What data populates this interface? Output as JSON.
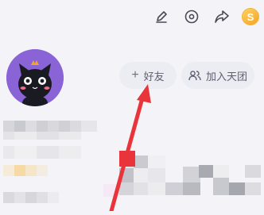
{
  "header": {
    "icons": [
      "edit-icon",
      "settings-icon",
      "share-icon",
      "coin-icon"
    ],
    "coin_label": "S"
  },
  "actions": {
    "add_friend_label": "好友",
    "add_friend_prefix": "+",
    "join_group_label": "加入天团"
  },
  "annotation": {
    "arrow_color": "#e8343a"
  }
}
